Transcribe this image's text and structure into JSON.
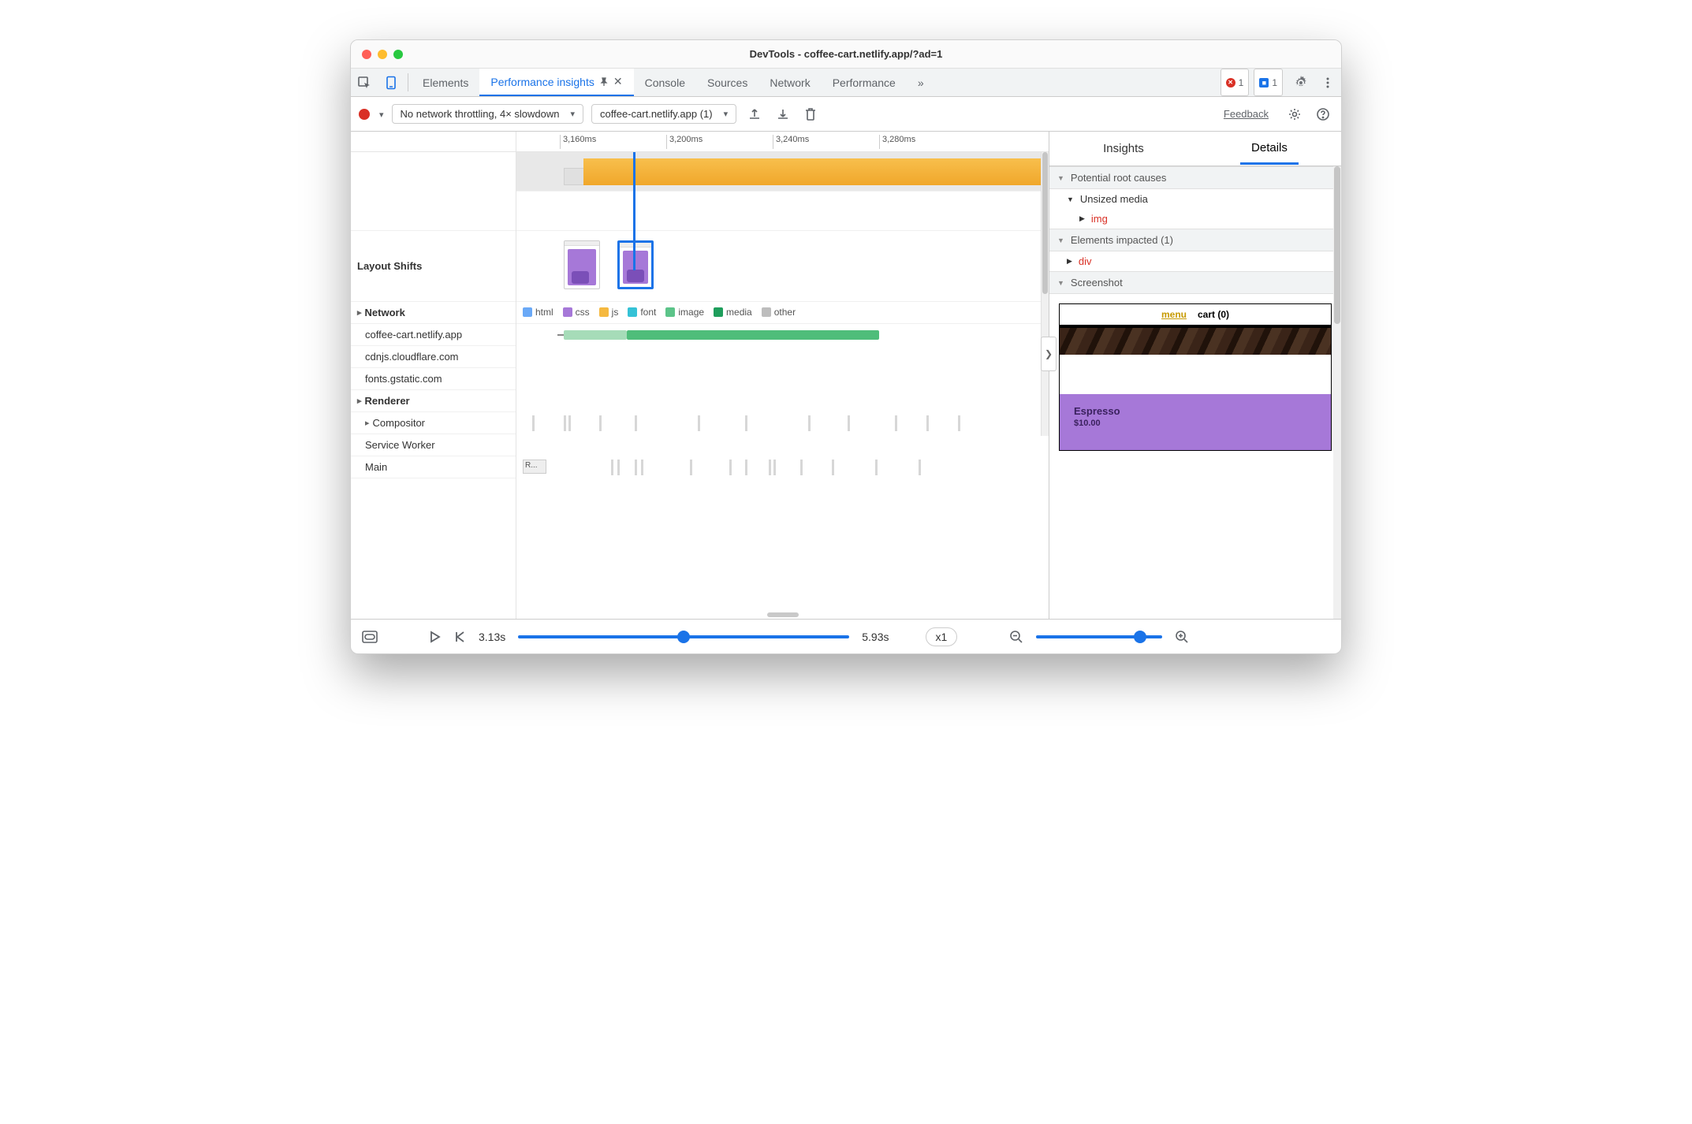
{
  "window": {
    "title": "DevTools - coffee-cart.netlify.app/?ad=1"
  },
  "tabs": {
    "elements": "Elements",
    "perf_insights": "Performance insights",
    "console": "Console",
    "sources": "Sources",
    "network": "Network",
    "performance": "Performance",
    "more": "»",
    "error_count": "1",
    "issue_count": "1"
  },
  "toolbar": {
    "throttle": "No network throttling, 4× slowdown",
    "target": "coffee-cart.netlify.app (1)",
    "feedback": "Feedback"
  },
  "ruler": {
    "t1": "3,160ms",
    "t2": "3,200ms",
    "t3": "3,240ms",
    "t4": "3,280ms"
  },
  "tracks": {
    "layout_shifts": "Layout Shifts",
    "network": "Network",
    "host1": "coffee-cart.netlify.app",
    "host2": "cdnjs.cloudflare.com",
    "host3": "fonts.gstatic.com",
    "renderer": "Renderer",
    "compositor": "Compositor",
    "service_worker": "Service Worker",
    "main": "Main",
    "main_block": "R..."
  },
  "legend": {
    "html": "html",
    "css": "css",
    "js": "js",
    "font": "font",
    "image": "image",
    "media": "media",
    "other": "other"
  },
  "right": {
    "tab_insights": "Insights",
    "tab_details": "Details",
    "root_causes": "Potential root causes",
    "unsized_media": "Unsized media",
    "img": "img",
    "elements_impacted": "Elements impacted (1)",
    "div": "div",
    "screenshot": "Screenshot"
  },
  "screenshot": {
    "menu": "menu",
    "cart": "cart (0)",
    "product_name": "Espresso",
    "product_price": "$10.00"
  },
  "bottom": {
    "time_start": "3.13s",
    "time_end": "5.93s",
    "speed": "x1"
  }
}
